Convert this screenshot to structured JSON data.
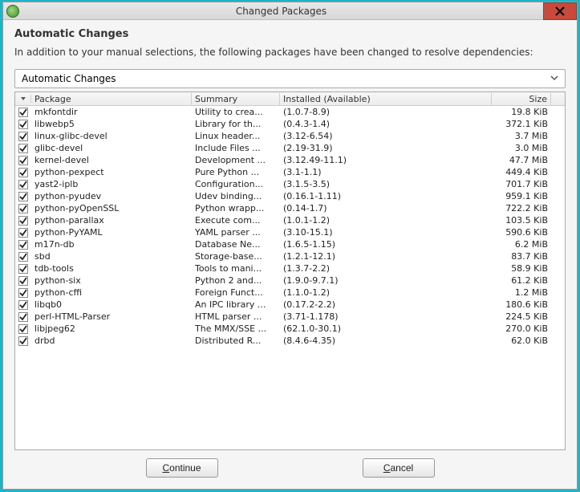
{
  "window": {
    "title": "Changed Packages"
  },
  "heading": "Automatic Changes",
  "description": "In addition to your manual selections, the following packages have been changed to resolve dependencies:",
  "dropdown": {
    "selected": "Automatic Changes"
  },
  "columns": {
    "pkg": "Package",
    "sum": "Summary",
    "inst": "Installed (Available)",
    "size": "Size"
  },
  "rows": [
    {
      "pkg": "mkfontdir",
      "sum": "Utility to crea...",
      "inst": "(1.0.7-8.9)",
      "size": "19.8 KiB"
    },
    {
      "pkg": "libwebp5",
      "sum": "Library for th...",
      "inst": "(0.4.3-1.4)",
      "size": "372.1 KiB"
    },
    {
      "pkg": "linux-glibc-devel",
      "sum": "Linux header...",
      "inst": "(3.12-6.54)",
      "size": "3.7 MiB"
    },
    {
      "pkg": "glibc-devel",
      "sum": "Include Files ...",
      "inst": "(2.19-31.9)",
      "size": "3.0 MiB"
    },
    {
      "pkg": "kernel-devel",
      "sum": "Development ...",
      "inst": "(3.12.49-11.1)",
      "size": "47.7 MiB"
    },
    {
      "pkg": "python-pexpect",
      "sum": "Pure Python ...",
      "inst": "(3.1-1.1)",
      "size": "449.4 KiB"
    },
    {
      "pkg": "yast2-iplb",
      "sum": "Configuration...",
      "inst": "(3.1.5-3.5)",
      "size": "701.7 KiB"
    },
    {
      "pkg": "python-pyudev",
      "sum": "Udev binding...",
      "inst": "(0.16.1-1.11)",
      "size": "959.1 KiB"
    },
    {
      "pkg": "python-pyOpenSSL",
      "sum": "Python wrapp...",
      "inst": "(0.14-1.7)",
      "size": "722.2 KiB"
    },
    {
      "pkg": "python-parallax",
      "sum": "Execute com...",
      "inst": "(1.0.1-1.2)",
      "size": "103.5 KiB"
    },
    {
      "pkg": "python-PyYAML",
      "sum": "YAML parser ...",
      "inst": "(3.10-15.1)",
      "size": "590.6 KiB"
    },
    {
      "pkg": "m17n-db",
      "sum": "Database Ne...",
      "inst": "(1.6.5-1.15)",
      "size": "6.2 MiB"
    },
    {
      "pkg": "sbd",
      "sum": "Storage-base...",
      "inst": "(1.2.1-12.1)",
      "size": "83.7 KiB"
    },
    {
      "pkg": "tdb-tools",
      "sum": "Tools to mani...",
      "inst": "(1.3.7-2.2)",
      "size": "58.9 KiB"
    },
    {
      "pkg": "python-six",
      "sum": "Python 2 and...",
      "inst": "(1.9.0-9.7.1)",
      "size": "61.2 KiB"
    },
    {
      "pkg": "python-cffi",
      "sum": "Foreign Funct...",
      "inst": "(1.1.0-1.2)",
      "size": "1.2 MiB"
    },
    {
      "pkg": "libqb0",
      "sum": "An IPC library ...",
      "inst": "(0.17.2-2.2)",
      "size": "180.6 KiB"
    },
    {
      "pkg": "perl-HTML-Parser",
      "sum": "HTML parser ...",
      "inst": "(3.71-1.178)",
      "size": "224.5 KiB"
    },
    {
      "pkg": "libjpeg62",
      "sum": "The MMX/SSE ...",
      "inst": "(62.1.0-30.1)",
      "size": "270.0 KiB"
    },
    {
      "pkg": "drbd",
      "sum": "Distributed R...",
      "inst": "(8.4.6-4.35)",
      "size": "62.0 KiB"
    }
  ],
  "buttons": {
    "continue": "ontinue",
    "continue_m": "C",
    "cancel": "ancel",
    "cancel_m": "C"
  }
}
